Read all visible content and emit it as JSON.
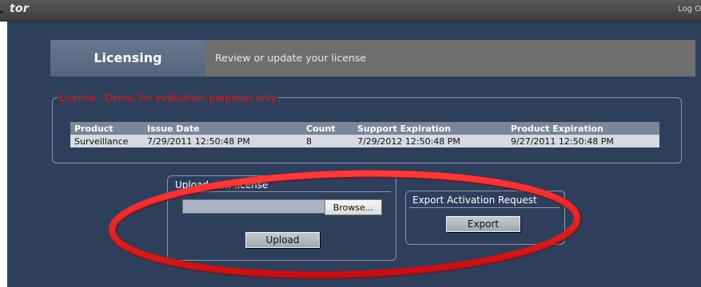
{
  "header": {
    "app_title_fragment": "tor",
    "logout_label": "Log O"
  },
  "banner": {
    "title": "Licensing",
    "subtitle": "Review or update your license"
  },
  "license": {
    "legend": "License - Demo, for evaluation purposes only",
    "columns": [
      "Product",
      "Issue Date",
      "Count",
      "Support Expiration",
      "Product Expiration"
    ],
    "rows": [
      [
        "Surveillance",
        "7/29/2011 12:50:48 PM",
        "8",
        "7/29/2012 12:50:48 PM",
        "9/27/2011 12:50:48 PM"
      ]
    ]
  },
  "upload": {
    "legend": "Upload new license",
    "file_value": "",
    "browse_label": "Browse...",
    "upload_label": "Upload"
  },
  "export": {
    "legend": "Export Activation Request",
    "export_label": "Export"
  },
  "colors": {
    "background": "#2e3f5c",
    "legend_warning": "#e01818",
    "annotation": "#e8141b"
  },
  "annotation": {
    "shape": "ellipse",
    "meaning": "highlight"
  }
}
